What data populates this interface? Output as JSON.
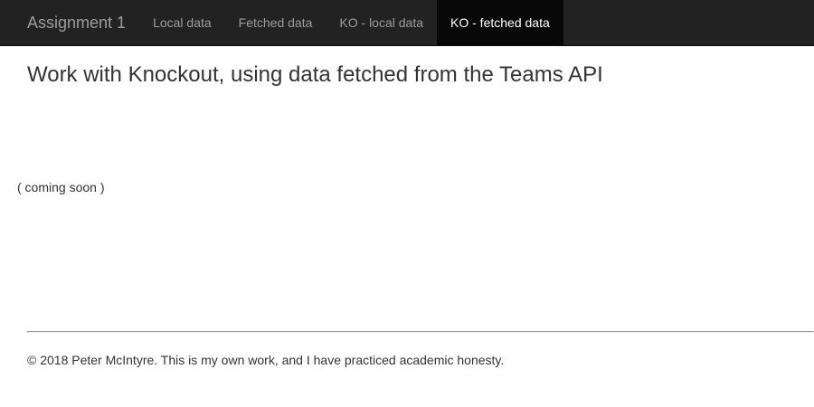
{
  "navbar": {
    "brand": "Assignment 1",
    "items": [
      {
        "label": "Local data",
        "active": false
      },
      {
        "label": "Fetched data",
        "active": false
      },
      {
        "label": "KO - local data",
        "active": false
      },
      {
        "label": "KO - fetched data",
        "active": true
      }
    ]
  },
  "main": {
    "title": "Work with Knockout, using data fetched from the Teams API",
    "placeholder": "( coming soon )"
  },
  "footer": {
    "text": "© 2018 Peter McIntyre. This is my own work, and I have practiced academic honesty."
  },
  "colors": {
    "navbar_bg": "#222222",
    "navbar_active_bg": "#080808",
    "navbar_text": "#9d9d9d",
    "navbar_active_text": "#ffffff",
    "body_text": "#333333"
  }
}
